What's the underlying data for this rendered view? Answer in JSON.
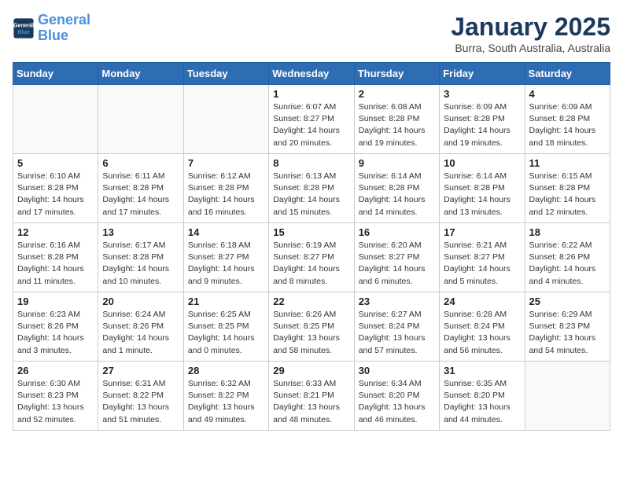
{
  "header": {
    "logo_line1": "General",
    "logo_line2": "Blue",
    "month": "January 2025",
    "location": "Burra, South Australia, Australia"
  },
  "weekdays": [
    "Sunday",
    "Monday",
    "Tuesday",
    "Wednesday",
    "Thursday",
    "Friday",
    "Saturday"
  ],
  "weeks": [
    [
      {
        "day": "",
        "info": ""
      },
      {
        "day": "",
        "info": ""
      },
      {
        "day": "",
        "info": ""
      },
      {
        "day": "1",
        "info": "Sunrise: 6:07 AM\nSunset: 8:27 PM\nDaylight: 14 hours\nand 20 minutes."
      },
      {
        "day": "2",
        "info": "Sunrise: 6:08 AM\nSunset: 8:28 PM\nDaylight: 14 hours\nand 19 minutes."
      },
      {
        "day": "3",
        "info": "Sunrise: 6:09 AM\nSunset: 8:28 PM\nDaylight: 14 hours\nand 19 minutes."
      },
      {
        "day": "4",
        "info": "Sunrise: 6:09 AM\nSunset: 8:28 PM\nDaylight: 14 hours\nand 18 minutes."
      }
    ],
    [
      {
        "day": "5",
        "info": "Sunrise: 6:10 AM\nSunset: 8:28 PM\nDaylight: 14 hours\nand 17 minutes."
      },
      {
        "day": "6",
        "info": "Sunrise: 6:11 AM\nSunset: 8:28 PM\nDaylight: 14 hours\nand 17 minutes."
      },
      {
        "day": "7",
        "info": "Sunrise: 6:12 AM\nSunset: 8:28 PM\nDaylight: 14 hours\nand 16 minutes."
      },
      {
        "day": "8",
        "info": "Sunrise: 6:13 AM\nSunset: 8:28 PM\nDaylight: 14 hours\nand 15 minutes."
      },
      {
        "day": "9",
        "info": "Sunrise: 6:14 AM\nSunset: 8:28 PM\nDaylight: 14 hours\nand 14 minutes."
      },
      {
        "day": "10",
        "info": "Sunrise: 6:14 AM\nSunset: 8:28 PM\nDaylight: 14 hours\nand 13 minutes."
      },
      {
        "day": "11",
        "info": "Sunrise: 6:15 AM\nSunset: 8:28 PM\nDaylight: 14 hours\nand 12 minutes."
      }
    ],
    [
      {
        "day": "12",
        "info": "Sunrise: 6:16 AM\nSunset: 8:28 PM\nDaylight: 14 hours\nand 11 minutes."
      },
      {
        "day": "13",
        "info": "Sunrise: 6:17 AM\nSunset: 8:28 PM\nDaylight: 14 hours\nand 10 minutes."
      },
      {
        "day": "14",
        "info": "Sunrise: 6:18 AM\nSunset: 8:27 PM\nDaylight: 14 hours\nand 9 minutes."
      },
      {
        "day": "15",
        "info": "Sunrise: 6:19 AM\nSunset: 8:27 PM\nDaylight: 14 hours\nand 8 minutes."
      },
      {
        "day": "16",
        "info": "Sunrise: 6:20 AM\nSunset: 8:27 PM\nDaylight: 14 hours\nand 6 minutes."
      },
      {
        "day": "17",
        "info": "Sunrise: 6:21 AM\nSunset: 8:27 PM\nDaylight: 14 hours\nand 5 minutes."
      },
      {
        "day": "18",
        "info": "Sunrise: 6:22 AM\nSunset: 8:26 PM\nDaylight: 14 hours\nand 4 minutes."
      }
    ],
    [
      {
        "day": "19",
        "info": "Sunrise: 6:23 AM\nSunset: 8:26 PM\nDaylight: 14 hours\nand 3 minutes."
      },
      {
        "day": "20",
        "info": "Sunrise: 6:24 AM\nSunset: 8:26 PM\nDaylight: 14 hours\nand 1 minute."
      },
      {
        "day": "21",
        "info": "Sunrise: 6:25 AM\nSunset: 8:25 PM\nDaylight: 14 hours\nand 0 minutes."
      },
      {
        "day": "22",
        "info": "Sunrise: 6:26 AM\nSunset: 8:25 PM\nDaylight: 13 hours\nand 58 minutes."
      },
      {
        "day": "23",
        "info": "Sunrise: 6:27 AM\nSunset: 8:24 PM\nDaylight: 13 hours\nand 57 minutes."
      },
      {
        "day": "24",
        "info": "Sunrise: 6:28 AM\nSunset: 8:24 PM\nDaylight: 13 hours\nand 56 minutes."
      },
      {
        "day": "25",
        "info": "Sunrise: 6:29 AM\nSunset: 8:23 PM\nDaylight: 13 hours\nand 54 minutes."
      }
    ],
    [
      {
        "day": "26",
        "info": "Sunrise: 6:30 AM\nSunset: 8:23 PM\nDaylight: 13 hours\nand 52 minutes."
      },
      {
        "day": "27",
        "info": "Sunrise: 6:31 AM\nSunset: 8:22 PM\nDaylight: 13 hours\nand 51 minutes."
      },
      {
        "day": "28",
        "info": "Sunrise: 6:32 AM\nSunset: 8:22 PM\nDaylight: 13 hours\nand 49 minutes."
      },
      {
        "day": "29",
        "info": "Sunrise: 6:33 AM\nSunset: 8:21 PM\nDaylight: 13 hours\nand 48 minutes."
      },
      {
        "day": "30",
        "info": "Sunrise: 6:34 AM\nSunset: 8:20 PM\nDaylight: 13 hours\nand 46 minutes."
      },
      {
        "day": "31",
        "info": "Sunrise: 6:35 AM\nSunset: 8:20 PM\nDaylight: 13 hours\nand 44 minutes."
      },
      {
        "day": "",
        "info": ""
      }
    ]
  ]
}
